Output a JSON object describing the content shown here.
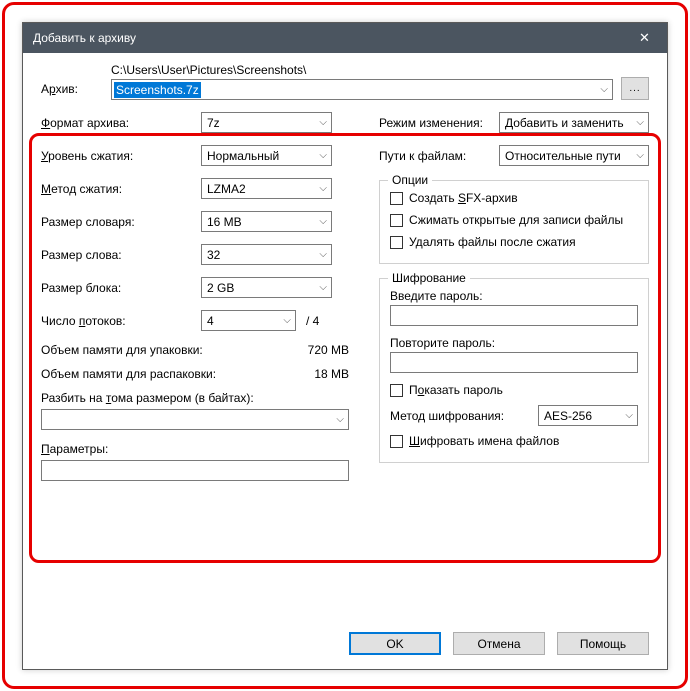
{
  "title": "Добавить к архиву",
  "archive": {
    "label_pre": "А",
    "label_ul": "р",
    "label_post": "хив:",
    "path": "C:\\Users\\User\\Pictures\\Screenshots\\",
    "filename": "Screenshots.7z",
    "browse": "..."
  },
  "left": {
    "format": {
      "label_ul": "Ф",
      "label": "ормат архива:",
      "value": "7z"
    },
    "level": {
      "label_ul": "У",
      "label": "ровень сжатия:",
      "value": "Нормальный"
    },
    "method": {
      "label_ul": "М",
      "label": "етод сжатия:",
      "value": "LZMA2"
    },
    "dict": {
      "label": "Размер словаря:",
      "value": "16 MB"
    },
    "word": {
      "label": "Размер слова:",
      "value": "32"
    },
    "block": {
      "label": "Размер блока:",
      "value": "2 GB"
    },
    "threads": {
      "label_pre": "Число ",
      "label_ul": "п",
      "label_post": "отоков:",
      "value": "4",
      "max": "/ 4"
    },
    "mem_pack": {
      "label": "Объем памяти для упаковки:",
      "value": "720 MB"
    },
    "mem_unpack": {
      "label": "Объем памяти для распаковки:",
      "value": "18 MB"
    },
    "split": {
      "label_pre": "Разбить на ",
      "label_ul": "т",
      "label_post": "ома размером (в байтах):"
    },
    "params": {
      "label_ul": "П",
      "label": "араметры:"
    }
  },
  "right": {
    "mode": {
      "label": "Режим изменения:",
      "value": "Добавить и заменить"
    },
    "paths": {
      "label": "Пути к файлам:",
      "value": "Относительные пути"
    },
    "options_legend": "Опции",
    "sfx": {
      "pre": "Создать ",
      "ul": "S",
      "post": "FX-архив"
    },
    "compress_open": "Сжимать открытые для записи файлы",
    "delete_after": "Удалять файлы после сжатия",
    "enc_legend": "Шифрование",
    "enter_pw": "Введите пароль:",
    "repeat_pw": "Повторите пароль:",
    "show_pw": {
      "pre": "П",
      "ul": "о",
      "post": "казать пароль"
    },
    "enc_method": {
      "label": "Метод шифрования:",
      "value": "AES-256"
    },
    "enc_names": {
      "ul": "Ш",
      "post": "ифровать имена файлов"
    }
  },
  "buttons": {
    "ok": "OK",
    "cancel": "Отмена",
    "help": "Помощь"
  }
}
